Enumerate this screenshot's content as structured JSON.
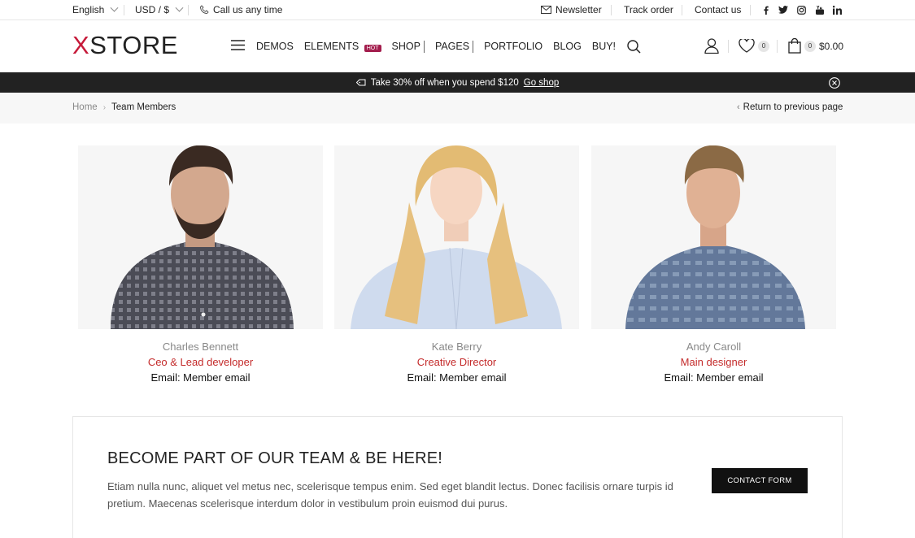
{
  "topbar": {
    "language": "English",
    "currency": "USD / $",
    "phone": "Call us any time",
    "newsletter": "Newsletter",
    "track_order": "Track order",
    "contact": "Contact us",
    "socials": [
      "facebook-icon",
      "twitter-icon",
      "instagram-icon",
      "youtube-icon",
      "linkedin-icon"
    ]
  },
  "header": {
    "logo_x": "X",
    "logo_rest": "STORE",
    "nav": {
      "demos": "DEMOS",
      "elements": "ELEMENTS",
      "hot": "HOT",
      "shop": "SHOP",
      "pages": "PAGES",
      "portfolio": "PORTFOLIO",
      "blog": "BLOG",
      "buy": "BUY!"
    },
    "wishlist_count": "0",
    "cart_count": "0",
    "cart_total": "$0.00"
  },
  "promo": {
    "text": "Take 30% off when you spend $120",
    "link": "Go shop"
  },
  "breadcrumb": {
    "home": "Home",
    "current": "Team Members",
    "back": "Return to previous page"
  },
  "team": [
    {
      "name": "Charles Bennett",
      "role": "Ceo & Lead developer",
      "email": "Email: Member email"
    },
    {
      "name": "Kate Berry",
      "role": "Creative Director",
      "email": "Email: Member email"
    },
    {
      "name": "Andy Caroll",
      "role": "Main designer",
      "email": "Email: Member email"
    }
  ],
  "join": {
    "title": "BECOME PART OF OUR TEAM & BE HERE!",
    "text": "Etiam nulla nunc, aliquet vel metus nec, scelerisque tempus enim. Sed eget blandit lectus. Donec facilisis ornare turpis id pretium. Maecenas scelerisque interdum dolor in vestibulum proin euismod dui purus.",
    "button": "CONTACT FORM"
  },
  "colors": {
    "accent": "#c42b2b",
    "logo_x": "#c61a3a",
    "promo_bg": "#222222",
    "hot_badge": "#a31d4d"
  }
}
